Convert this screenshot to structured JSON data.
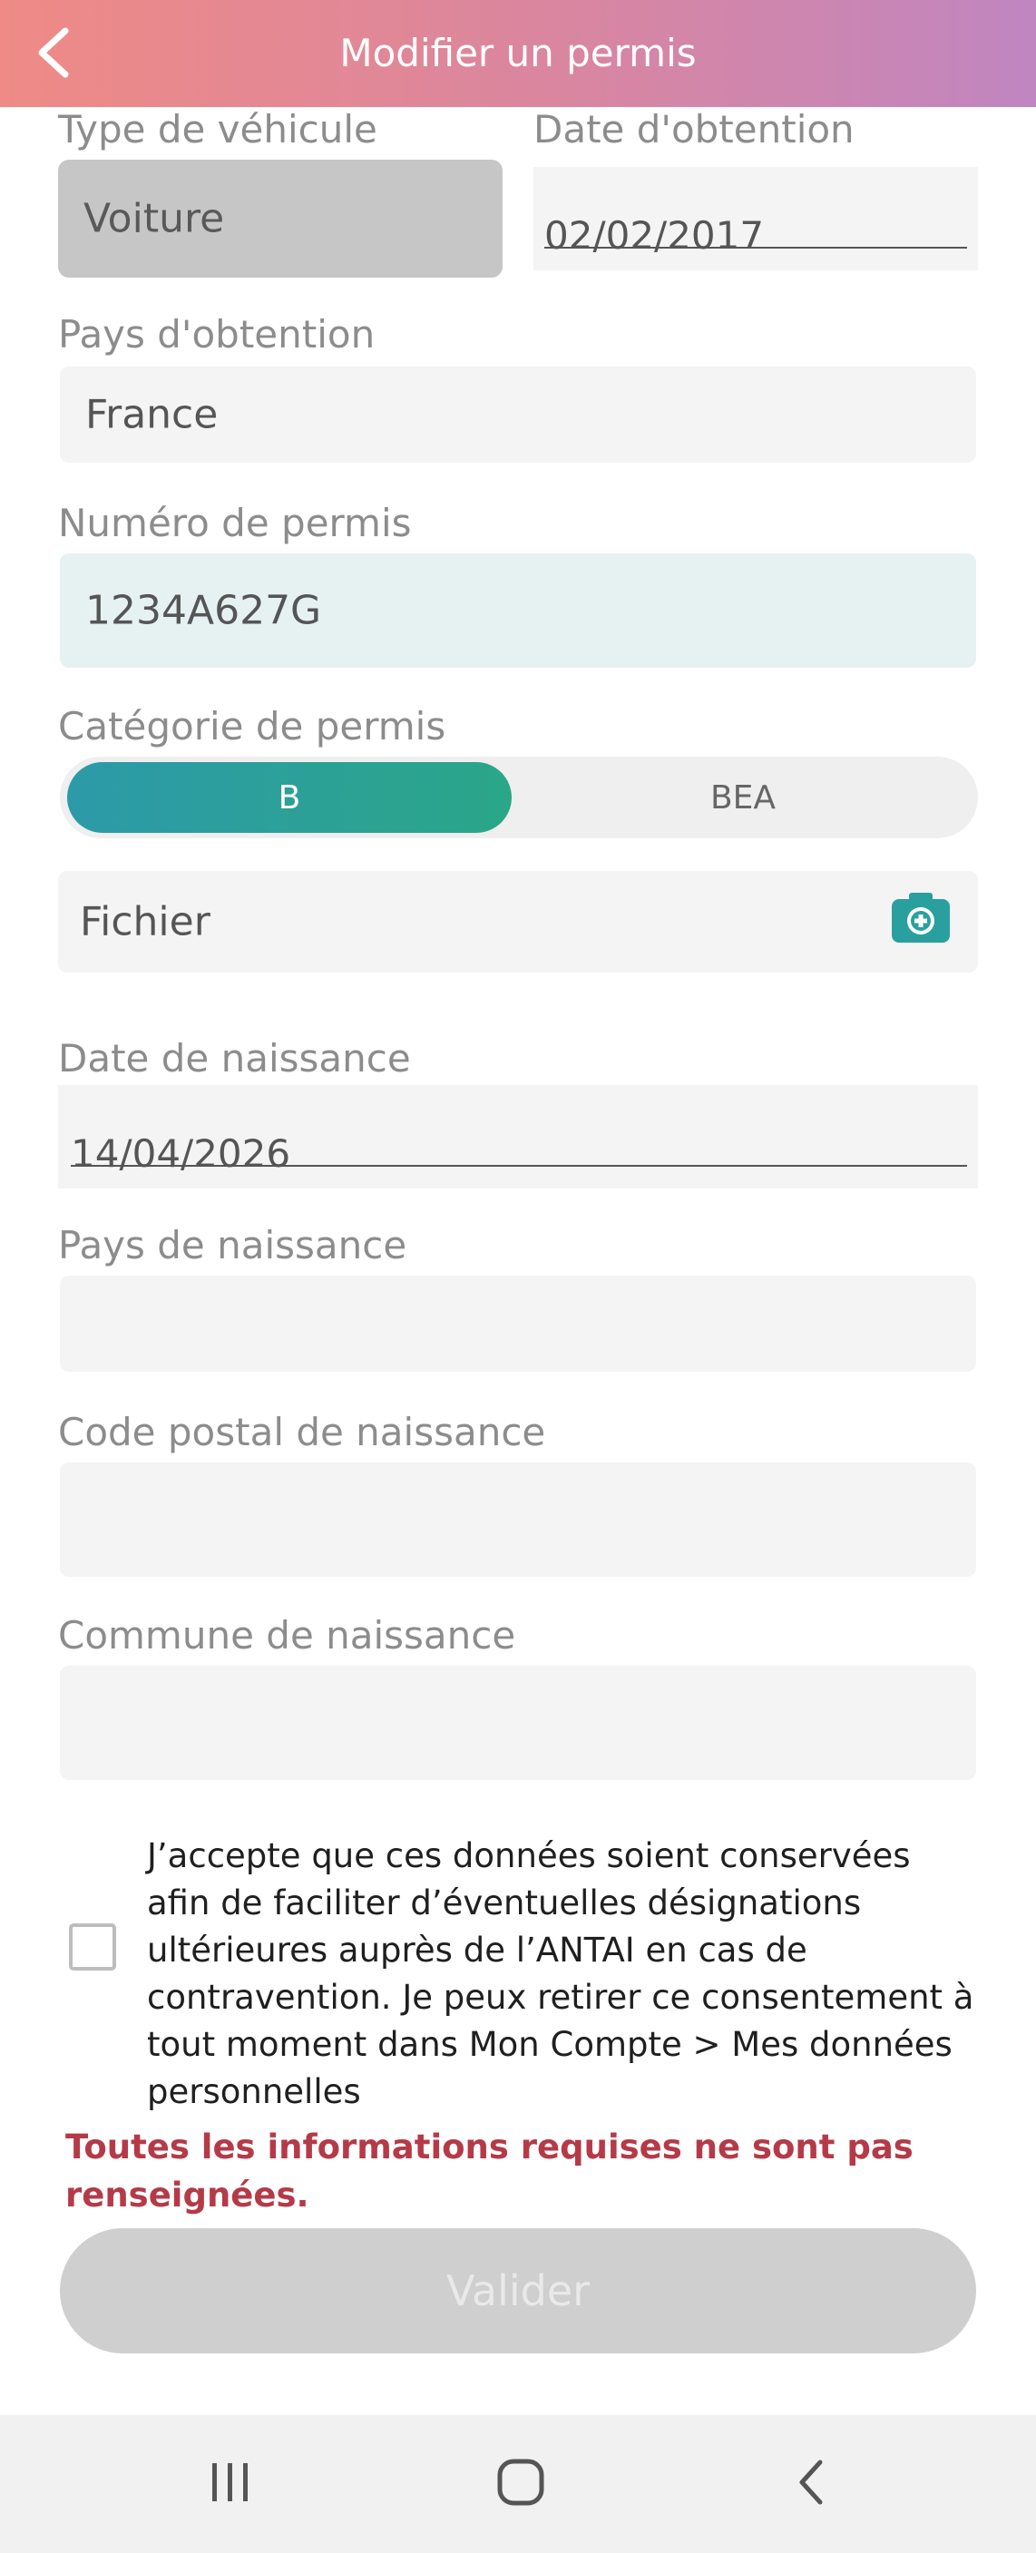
{
  "header": {
    "title": "Modifier un permis",
    "back_icon": "chevron-left-icon"
  },
  "form": {
    "vehicle_type": {
      "label": "Type de véhicule",
      "value": "Voiture"
    },
    "obtain_date": {
      "label": "Date d'obtention",
      "value": "02/02/2017"
    },
    "obtain_country": {
      "label": "Pays d'obtention",
      "value": "France"
    },
    "permit_number": {
      "label": "Numéro de permis",
      "value": "1234A627G"
    },
    "permit_category": {
      "label": "Catégorie de permis",
      "options": [
        "B",
        "BEA"
      ],
      "selected": "B"
    },
    "file": {
      "label": "Fichier",
      "icon": "camera-add-icon"
    },
    "birth_date": {
      "label": "Date de naissance",
      "value": "14/04/2026"
    },
    "birth_country": {
      "label": "Pays de naissance",
      "value": ""
    },
    "birth_postal_code": {
      "label": "Code postal de naissance",
      "value": ""
    },
    "birth_town": {
      "label": "Commune de naissance",
      "value": ""
    }
  },
  "consent": {
    "checked": false,
    "text": "J’accepte que ces données soient conservées afin de faciliter d’éventuelles désignations ultérieures auprès de l’ANTAI en cas de contravention. Je peux retirer ce consentement à tout moment dans Mon Compte > Mes données personnelles"
  },
  "error_message": "Toutes les informations requises ne sont pas renseignées.",
  "submit_label": "Valider",
  "colors": {
    "header_gradient_start": "#ef8a86",
    "header_gradient_end": "#c086c0",
    "accent_teal": "#2a9fa0",
    "error": "#b53a48"
  },
  "system_nav": {
    "recents_icon": "recent-apps-icon",
    "home_icon": "home-icon",
    "back_icon": "system-back-icon"
  }
}
